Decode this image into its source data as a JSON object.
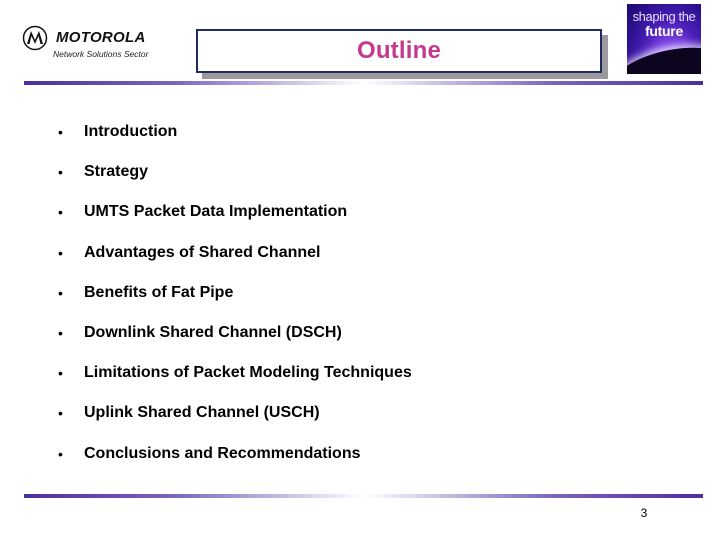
{
  "header": {
    "brand": {
      "wordmark": "MOTOROLA",
      "sector": "Network Solutions Sector",
      "emblem_icon": "motorola-batwing-icon"
    },
    "title": "Outline",
    "tagline_logo": {
      "line1": "shaping the",
      "line2": "future"
    }
  },
  "outline": {
    "items": [
      {
        "bullet": "•",
        "label": "Introduction"
      },
      {
        "bullet": "•",
        "label": "Strategy"
      },
      {
        "bullet": "•",
        "label": "UMTS Packet Data Implementation"
      },
      {
        "bullet": "•",
        "label": "Advantages of Shared Channel"
      },
      {
        "bullet": "•",
        "label": "Benefits of Fat Pipe"
      },
      {
        "bullet": "•",
        "label": "Downlink Shared Channel (DSCH)"
      },
      {
        "bullet": "•",
        "label": "Limitations of Packet Modeling Techniques"
      },
      {
        "bullet": "•",
        "label": "Uplink Shared Channel (USCH)"
      },
      {
        "bullet": "•",
        "label": "Conclusions and Recommendations"
      }
    ]
  },
  "footer": {
    "page_number": "3"
  },
  "colors": {
    "title": "#c4388f",
    "title_border": "#1f2a63",
    "divider": "#4b2fa0",
    "text": "#000000"
  }
}
